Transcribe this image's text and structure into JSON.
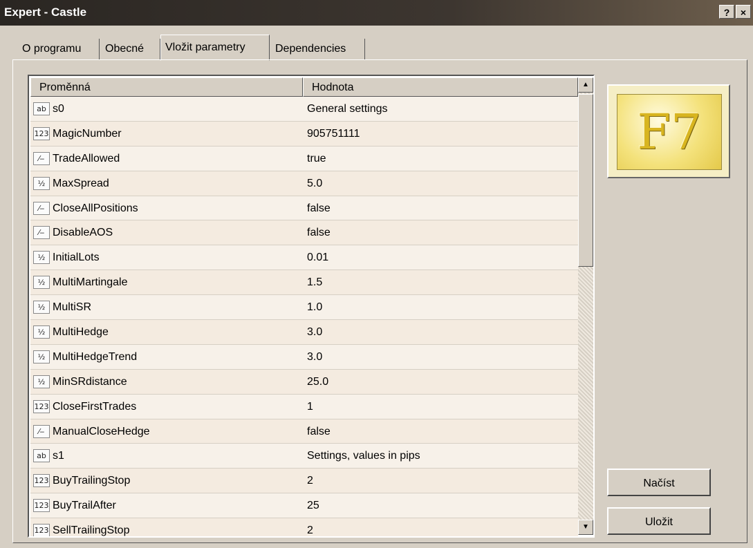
{
  "window": {
    "title": "Expert - Castle",
    "help_label": "?",
    "close_label": "×"
  },
  "tabs": [
    {
      "label": "O programu"
    },
    {
      "label": "Obecné"
    },
    {
      "label": "Vložit parametry"
    },
    {
      "label": "Dependencies"
    }
  ],
  "grid": {
    "columns": [
      "Proměnná",
      "Hodnota"
    ],
    "rows": [
      {
        "icon": "ab",
        "name": "s0",
        "value": "General settings"
      },
      {
        "icon": "123",
        "name": "MagicNumber",
        "value": "905751111"
      },
      {
        "icon": "bool",
        "name": "TradeAllowed",
        "value": "true"
      },
      {
        "icon": "v2",
        "name": "MaxSpread",
        "value": "5.0"
      },
      {
        "icon": "bool",
        "name": "CloseAllPositions",
        "value": "false"
      },
      {
        "icon": "bool",
        "name": "DisableAOS",
        "value": "false"
      },
      {
        "icon": "v2",
        "name": "InitialLots",
        "value": "0.01"
      },
      {
        "icon": "v2",
        "name": "MultiMartingale",
        "value": "1.5"
      },
      {
        "icon": "v2",
        "name": "MultiSR",
        "value": "1.0"
      },
      {
        "icon": "v2",
        "name": "MultiHedge",
        "value": "3.0"
      },
      {
        "icon": "v2",
        "name": "MultiHedgeTrend",
        "value": "3.0"
      },
      {
        "icon": "v2",
        "name": "MinSRdistance",
        "value": "25.0"
      },
      {
        "icon": "123",
        "name": "CloseFirstTrades",
        "value": "1"
      },
      {
        "icon": "bool",
        "name": "ManualCloseHedge",
        "value": "false"
      },
      {
        "icon": "ab",
        "name": "s1",
        "value": "Settings, values in pips"
      },
      {
        "icon": "123",
        "name": "BuyTrailingStop",
        "value": "2"
      },
      {
        "icon": "123",
        "name": "BuyTrailAfter",
        "value": "25"
      },
      {
        "icon": "123",
        "name": "SellTrailingStop",
        "value": "2"
      }
    ],
    "scroll_up": "▲",
    "scroll_down": "▼"
  },
  "logo": {
    "text": "F7"
  },
  "buttons": {
    "load": "Načíst",
    "save": "Uložit"
  },
  "icon_glyphs": {
    "ab": "ab",
    "123": "123",
    "bool": "⁄‒",
    "v2": "½"
  }
}
